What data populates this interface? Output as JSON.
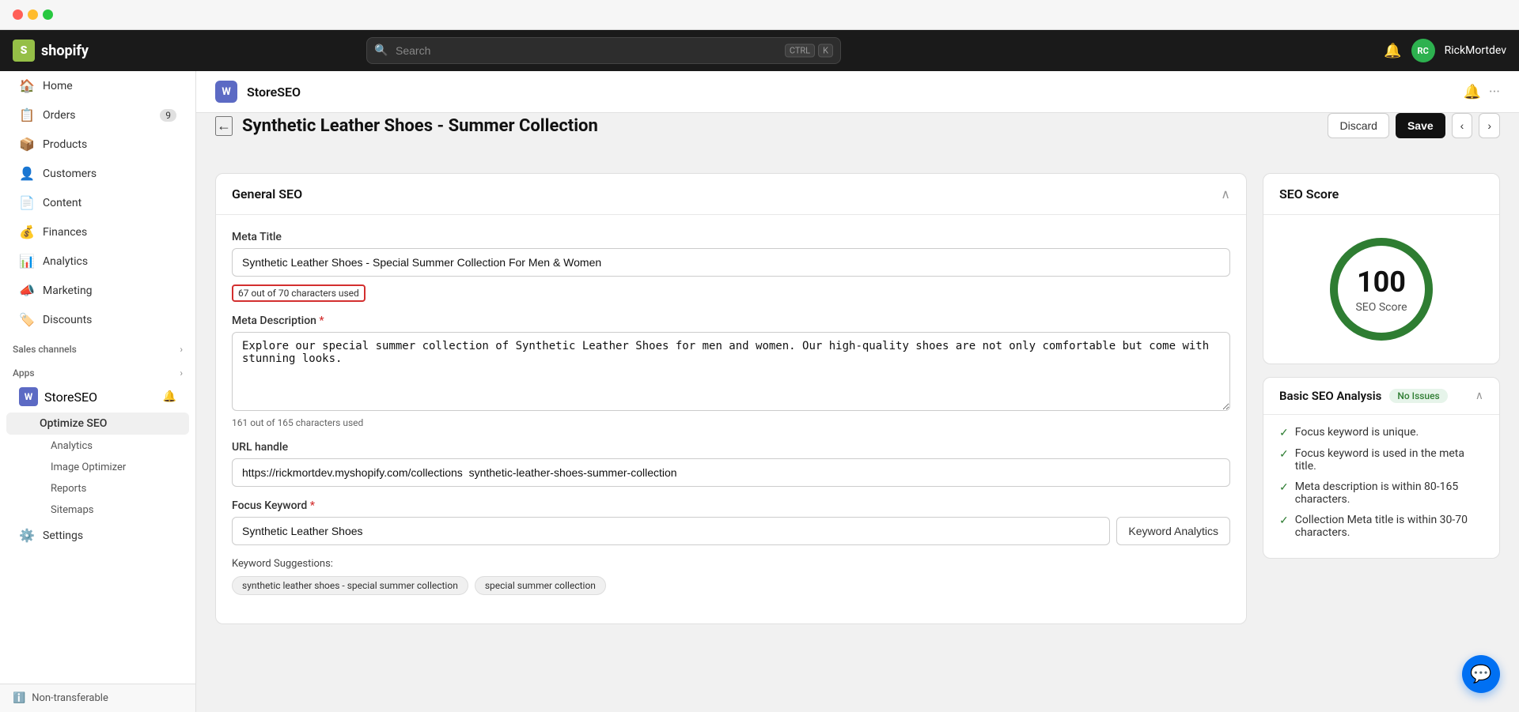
{
  "window": {
    "mac_controls": true
  },
  "topbar": {
    "logo_text": "shopify",
    "search_placeholder": "Search",
    "shortcut_ctrl": "CTRL",
    "shortcut_key": "K",
    "username": "RickMortdev",
    "avatar_initials": "RC"
  },
  "sidebar": {
    "nav_items": [
      {
        "id": "home",
        "label": "Home",
        "icon": "🏠",
        "badge": null
      },
      {
        "id": "orders",
        "label": "Orders",
        "icon": "📋",
        "badge": "9"
      },
      {
        "id": "products",
        "label": "Products",
        "icon": "📦",
        "badge": null
      },
      {
        "id": "customers",
        "label": "Customers",
        "icon": "👤",
        "badge": null
      },
      {
        "id": "content",
        "label": "Content",
        "icon": "📄",
        "badge": null
      },
      {
        "id": "finances",
        "label": "Finances",
        "icon": "💰",
        "badge": null
      },
      {
        "id": "analytics",
        "label": "Analytics",
        "icon": "📊",
        "badge": null
      },
      {
        "id": "marketing",
        "label": "Marketing",
        "icon": "📣",
        "badge": null
      },
      {
        "id": "discounts",
        "label": "Discounts",
        "icon": "🏷️",
        "badge": null
      }
    ],
    "sales_channels_label": "Sales channels",
    "apps_label": "Apps",
    "storeseo_label": "StoreSEO",
    "optimize_seo_label": "Optimize SEO",
    "sub_items": [
      {
        "id": "analytics",
        "label": "Analytics"
      },
      {
        "id": "image-optimizer",
        "label": "Image Optimizer"
      },
      {
        "id": "reports",
        "label": "Reports"
      },
      {
        "id": "sitemaps",
        "label": "Sitemaps"
      }
    ],
    "settings_label": "Settings",
    "non_transferable_label": "Non-transferable"
  },
  "app_header": {
    "icon_text": "W",
    "title": "StoreSEO"
  },
  "page": {
    "back_label": "←",
    "title": "Synthetic Leather Shoes - Summer Collection",
    "discard_label": "Discard",
    "save_label": "Save",
    "nav_prev": "‹",
    "nav_next": "›"
  },
  "general_seo": {
    "section_title": "General SEO",
    "meta_title_label": "Meta Title",
    "meta_title_value": "Synthetic Leather Shoes - Special Summer Collection For Men & Women",
    "meta_title_counter": "67 out of 70 characters used",
    "meta_description_label": "Meta Description",
    "meta_description_value": "Explore our special summer collection of Synthetic Leather Shoes for men and women. Our high-quality shoes are not only comfortable but come with stunning looks.",
    "meta_description_counter": "161 out of 165 characters used",
    "url_handle_label": "URL handle",
    "url_handle_value": "https://rickmortdev.myshopify.com/collections  synthetic-leather-shoes-summer-collection",
    "focus_keyword_label": "Focus Keyword",
    "focus_keyword_required": "*",
    "focus_keyword_value": "Synthetic Leather Shoes",
    "keyword_analytics_btn": "Keyword Analytics",
    "keyword_suggestions_label": "Keyword Suggestions:",
    "keyword_chips": [
      "synthetic leather shoes - special summer collection",
      "special summer collection"
    ]
  },
  "seo_score": {
    "title": "SEO Score",
    "score": "100",
    "score_label": "SEO Score",
    "circle_color": "#2e7d32",
    "circle_bg": "#e8e8e8",
    "radius": 60,
    "stroke_width": 10
  },
  "basic_seo": {
    "title": "Basic SEO Analysis",
    "badge": "No Issues",
    "items": [
      "Focus keyword is unique.",
      "Focus keyword is used in the meta title.",
      "Meta description is within 80-165 characters.",
      "Collection Meta title is within 30-70 characters."
    ]
  }
}
